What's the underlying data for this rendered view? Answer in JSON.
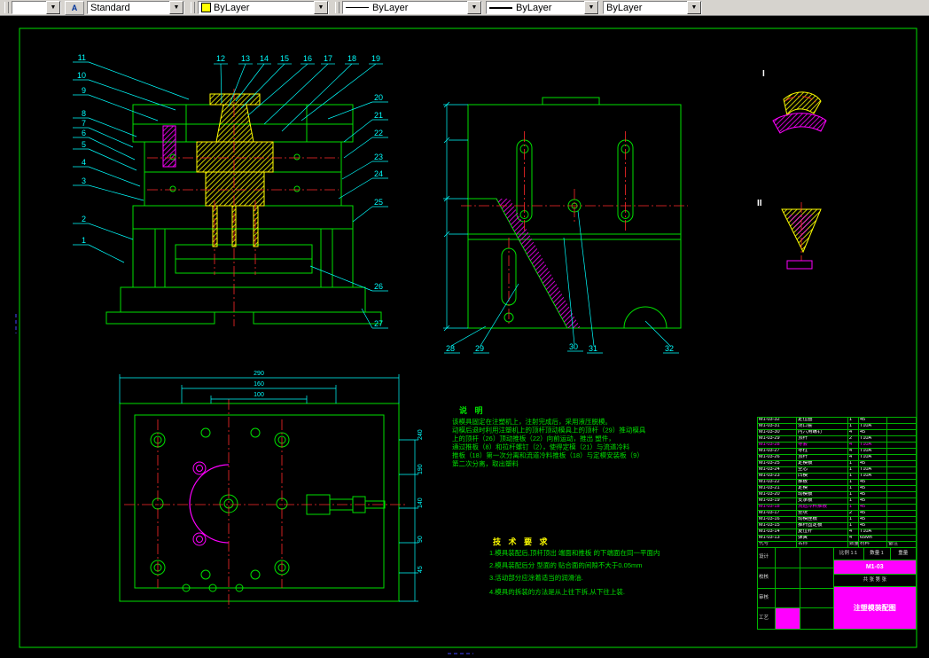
{
  "toolbar": {
    "left_combo": {
      "value": ""
    },
    "style_button": {
      "glyph": "A"
    },
    "text_style_combo": {
      "value": "Standard"
    },
    "color_combo": {
      "value": "ByLayer",
      "swatch": "#ffff00"
    },
    "linetype_combo": {
      "value": "ByLayer"
    },
    "lineweight_combo": {
      "value": "ByLayer"
    },
    "plotstyle_combo": {
      "value": "ByLayer"
    }
  },
  "drawing": {
    "callouts": {
      "main": [
        "1",
        "2",
        "3",
        "4",
        "5",
        "6",
        "7",
        "8",
        "9",
        "10",
        "11",
        "12",
        "13",
        "14",
        "15",
        "16",
        "17",
        "18",
        "19",
        "20",
        "21",
        "22",
        "23",
        "24",
        "25",
        "26",
        "27"
      ],
      "side": [
        "28",
        "29",
        "30",
        "31",
        "32"
      ],
      "details": [
        "I",
        "II"
      ]
    },
    "notes": {
      "title": "说 明",
      "lines": [
        "该模具固定在注塑机上，注射完成后，采用液压脱模。",
        "动模后退时利用注塑机上的顶杆顶动模具上的顶杆（29）推动模具",
        "上的顶杆（26）顶动推板（22）向前运动，推出 塑件，",
        "通过推板（8）和拉杆螺钉（2），使得定模（21）与流道冷料",
        "推板（18）第一次分离和流道冷料推板（18）与定模安装板（9）",
        "第二次分离，取出塑料"
      ]
    },
    "tech": {
      "title": "技 术 要 求",
      "items": [
        "1.模具装配后,顶杆顶出 端面和推板 的下端面在同一平面内",
        "2.模具装配后分 型面的 贴合面的间隙不大于0.05mm",
        "3.活动部分应涂着适当的润滑油.",
        "4.模具的拆装的方法是从上往下拆,从下往上装."
      ]
    },
    "dims": {
      "plan_top": [
        "290",
        "160",
        "100"
      ],
      "plan_right": [
        "240",
        "190",
        "140",
        "90",
        "45"
      ]
    },
    "parts_table": {
      "headers": [
        "代号",
        "名称",
        "数量",
        "材料",
        "备注"
      ],
      "rows": [
        {
          "code": "M1-03-32",
          "name": "定位圈",
          "qty": "1",
          "mat": "45",
          "note": ""
        },
        {
          "code": "M1-03-31",
          "name": "浇口套",
          "qty": "1",
          "mat": "T10A",
          "note": ""
        },
        {
          "code": "M1-03-30",
          "name": "内六角螺钉",
          "qty": "4",
          "mat": "45",
          "note": ""
        },
        {
          "code": "M1-03-29",
          "name": "顶杆",
          "qty": "2",
          "mat": "T10A",
          "note": ""
        },
        {
          "code": "M1-03-28",
          "name": "导套",
          "qty": "4",
          "mat": "T10A",
          "note": "",
          "c": "#ff00ff"
        },
        {
          "code": "M1-03-27",
          "name": "导柱",
          "qty": "4",
          "mat": "T10A",
          "note": ""
        },
        {
          "code": "M1-03-26",
          "name": "顶杆",
          "qty": "4",
          "mat": "T10A",
          "note": ""
        },
        {
          "code": "M1-03-25",
          "name": "定模板",
          "qty": "1",
          "mat": "45",
          "note": ""
        },
        {
          "code": "M1-03-24",
          "name": "型芯",
          "qty": "1",
          "mat": "T10A",
          "note": ""
        },
        {
          "code": "M1-03-23",
          "name": "凹模",
          "qty": "1",
          "mat": "T10A",
          "note": ""
        },
        {
          "code": "M1-03-22",
          "name": "推板",
          "qty": "1",
          "mat": "45",
          "note": ""
        },
        {
          "code": "M1-03-21",
          "name": "定模",
          "qty": "1",
          "mat": "45",
          "note": ""
        },
        {
          "code": "M1-03-20",
          "name": "动模板",
          "qty": "1",
          "mat": "45",
          "note": ""
        },
        {
          "code": "M1-03-19",
          "name": "支承板",
          "qty": "1",
          "mat": "45",
          "note": ""
        },
        {
          "code": "M1-03-18",
          "name": "流道冷料推板",
          "qty": "1",
          "mat": "45",
          "note": "",
          "c": "#ff00ff"
        },
        {
          "code": "M1-03-17",
          "name": "垫块",
          "qty": "2",
          "mat": "45",
          "note": ""
        },
        {
          "code": "M1-03-16",
          "name": "动模座板",
          "qty": "1",
          "mat": "45",
          "note": ""
        },
        {
          "code": "M1-03-15",
          "name": "推杆固定板",
          "qty": "1",
          "mat": "45",
          "note": ""
        },
        {
          "code": "M1-03-14",
          "name": "复位杆",
          "qty": "4",
          "mat": "T10A",
          "note": ""
        },
        {
          "code": "M1-03-13",
          "name": "弹簧",
          "qty": "4",
          "mat": "65Mn",
          "note": ""
        }
      ]
    },
    "title_block": {
      "labels": [
        "设计",
        "校核",
        "审核",
        "工艺"
      ],
      "scale_label": "比例",
      "scale": "1:1",
      "qty_label": "数量",
      "qty": "1",
      "weight_label": "重量",
      "sheet_info": "共 张  第 张",
      "code": "M1-03",
      "name": "注塑模装配图"
    }
  }
}
